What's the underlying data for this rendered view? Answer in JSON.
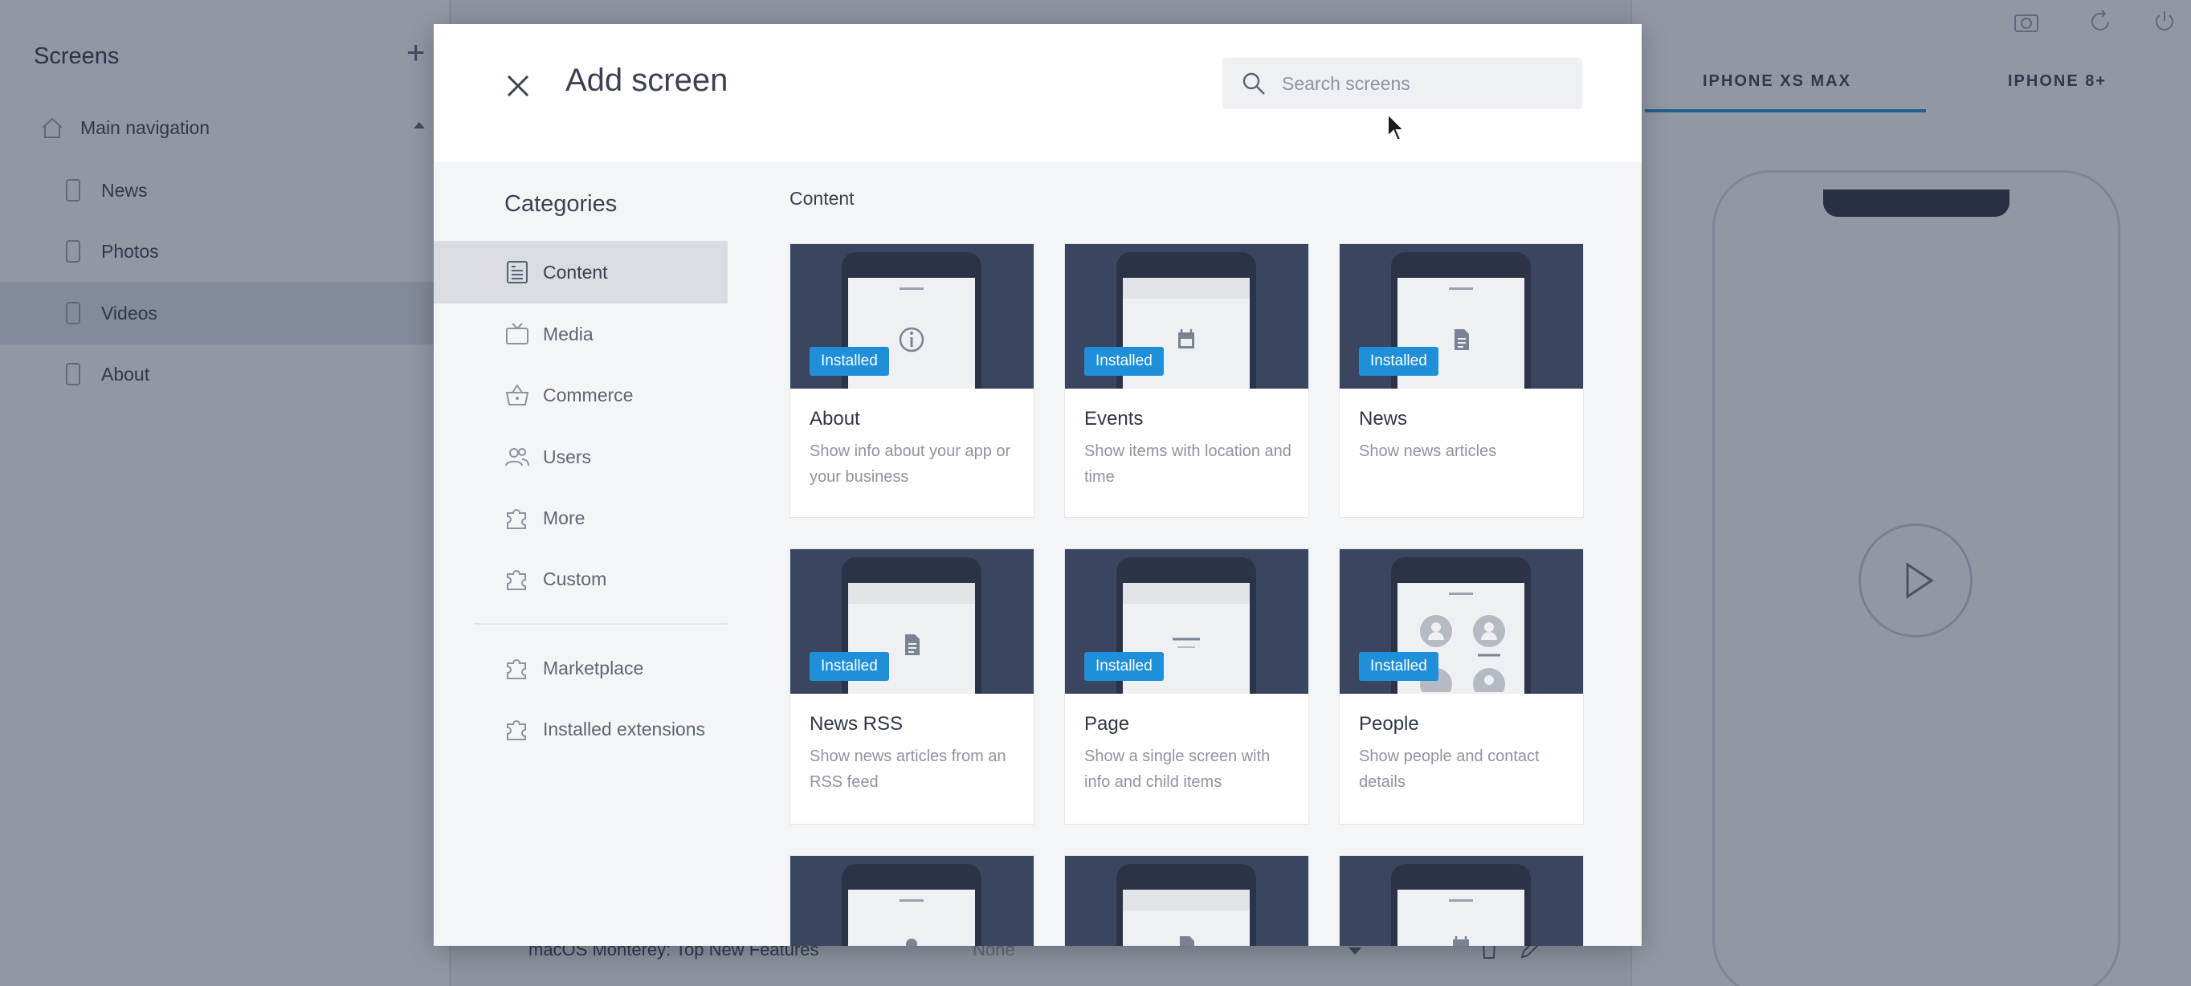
{
  "sidebar": {
    "title": "Screens",
    "add_label": "+",
    "group": "Main navigation",
    "items": [
      {
        "label": "News"
      },
      {
        "label": "Photos"
      },
      {
        "label": "Videos"
      },
      {
        "label": "About"
      }
    ]
  },
  "main": {
    "row_title": "macOS Monterey: Top New Features",
    "row_value": "None"
  },
  "preview": {
    "tabs": [
      "IPHONE XS MAX",
      "IPHONE 8+"
    ]
  },
  "modal": {
    "title": "Add screen",
    "search_placeholder": "Search screens",
    "categories_title": "Categories",
    "categories": [
      {
        "label": "Content",
        "icon": "content-icon"
      },
      {
        "label": "Media",
        "icon": "tv-icon"
      },
      {
        "label": "Commerce",
        "icon": "basket-icon"
      },
      {
        "label": "Users",
        "icon": "users-icon"
      },
      {
        "label": "More",
        "icon": "puzzle-icon"
      },
      {
        "label": "Custom",
        "icon": "puzzle-icon"
      },
      {
        "label": "Marketplace",
        "icon": "puzzle-icon"
      },
      {
        "label": "Installed extensions",
        "icon": "puzzle-icon"
      }
    ],
    "section_title": "Content",
    "badge_label": "Installed",
    "cards": [
      {
        "title": "About",
        "desc": "Show info about your app or your business",
        "icon": "info-icon"
      },
      {
        "title": "Events",
        "desc": "Show items with location and time",
        "icon": "calendar-icon"
      },
      {
        "title": "News",
        "desc": "Show news articles",
        "icon": "document-icon"
      },
      {
        "title": "News RSS",
        "desc": "Show news articles from an RSS feed",
        "icon": "document-icon"
      },
      {
        "title": "Page",
        "desc": "Show a single screen with info and child items",
        "icon": "text-lines-icon"
      },
      {
        "title": "People",
        "desc": "Show people and contact details",
        "icon": "person-icon"
      }
    ]
  },
  "colors": {
    "accent": "#1e8fd8",
    "overlay": "#26304a",
    "thumb_bg": "#3a4660"
  }
}
